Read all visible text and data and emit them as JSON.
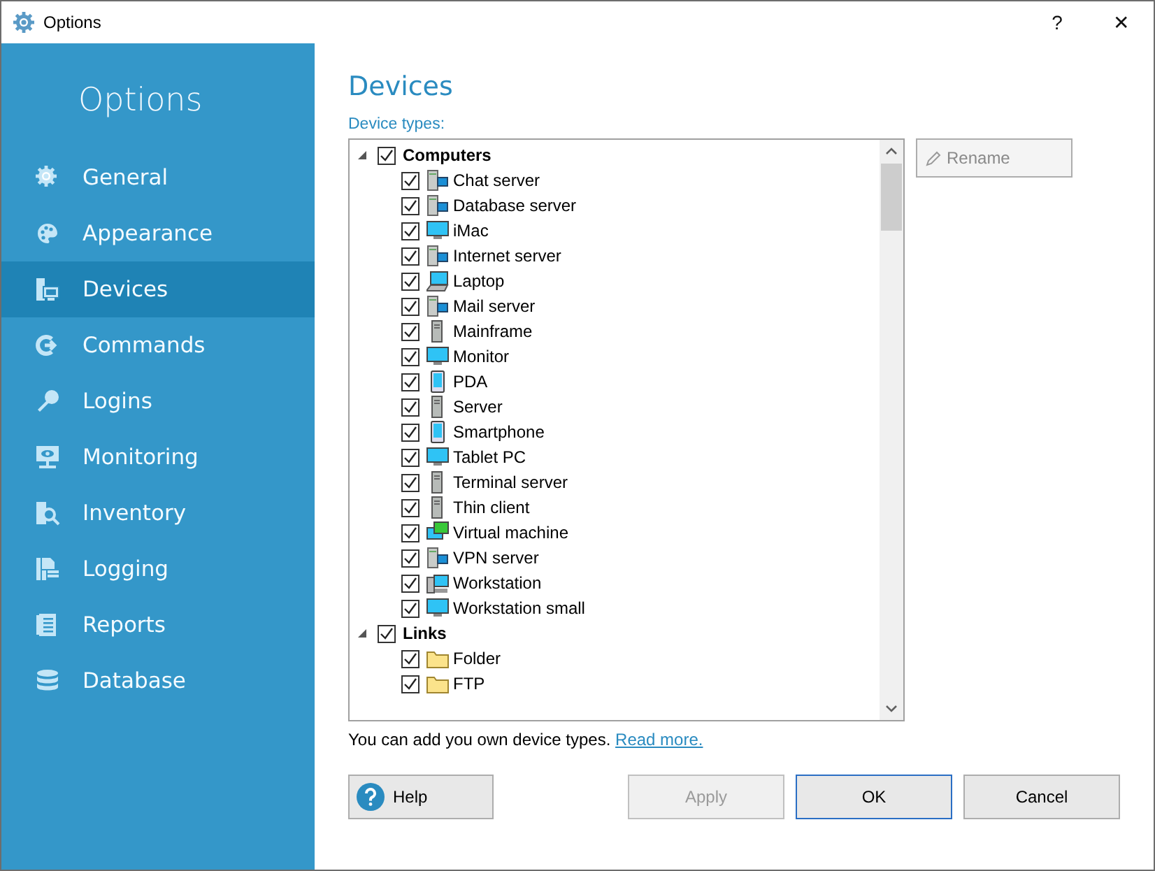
{
  "window": {
    "title": "Options",
    "help_glyph": "?",
    "close_glyph": "✕"
  },
  "sidebar": {
    "heading": "Options",
    "items": [
      {
        "label": "General",
        "selected": false
      },
      {
        "label": "Appearance",
        "selected": false
      },
      {
        "label": "Devices",
        "selected": true
      },
      {
        "label": "Commands",
        "selected": false
      },
      {
        "label": "Logins",
        "selected": false
      },
      {
        "label": "Monitoring",
        "selected": false
      },
      {
        "label": "Inventory",
        "selected": false
      },
      {
        "label": "Logging",
        "selected": false
      },
      {
        "label": "Reports",
        "selected": false
      },
      {
        "label": "Database",
        "selected": false
      }
    ]
  },
  "page": {
    "title": "Devices",
    "tree_label": "Device types:",
    "tree": [
      {
        "label": "Computers",
        "checked": true,
        "expanded": true,
        "children": [
          {
            "label": "Chat server",
            "checked": true,
            "kind": "server"
          },
          {
            "label": "Database server",
            "checked": true,
            "kind": "server"
          },
          {
            "label": "iMac",
            "checked": true,
            "kind": "display"
          },
          {
            "label": "Internet server",
            "checked": true,
            "kind": "server"
          },
          {
            "label": "Laptop",
            "checked": true,
            "kind": "laptop"
          },
          {
            "label": "Mail server",
            "checked": true,
            "kind": "server"
          },
          {
            "label": "Mainframe",
            "checked": true,
            "kind": "tower"
          },
          {
            "label": "Monitor",
            "checked": true,
            "kind": "display"
          },
          {
            "label": "PDA",
            "checked": true,
            "kind": "handheld"
          },
          {
            "label": "Server",
            "checked": true,
            "kind": "tower"
          },
          {
            "label": "Smartphone",
            "checked": true,
            "kind": "handheld"
          },
          {
            "label": "Tablet PC",
            "checked": true,
            "kind": "display"
          },
          {
            "label": "Terminal server",
            "checked": true,
            "kind": "tower"
          },
          {
            "label": "Thin client",
            "checked": true,
            "kind": "tower"
          },
          {
            "label": "Virtual machine",
            "checked": true,
            "kind": "virtual"
          },
          {
            "label": "VPN server",
            "checked": true,
            "kind": "server"
          },
          {
            "label": "Workstation",
            "checked": true,
            "kind": "workstation"
          },
          {
            "label": "Workstation small",
            "checked": true,
            "kind": "display"
          }
        ]
      },
      {
        "label": "Links",
        "checked": true,
        "expanded": true,
        "children": [
          {
            "label": "Folder",
            "checked": true,
            "kind": "folder"
          },
          {
            "label": "FTP",
            "checked": true,
            "kind": "folder"
          }
        ]
      }
    ],
    "rename_button": {
      "label": "Rename",
      "disabled": true
    },
    "hint": "You can add you own device types.",
    "hint_link": "Read more."
  },
  "buttons": [
    {
      "label": "Help",
      "kind": "help",
      "disabled": false,
      "default": false
    },
    {
      "label": "Apply",
      "kind": "plain",
      "disabled": true,
      "default": false
    },
    {
      "label": "OK",
      "kind": "plain",
      "disabled": false,
      "default": true
    },
    {
      "label": "Cancel",
      "kind": "plain",
      "disabled": false,
      "default": false
    }
  ]
}
